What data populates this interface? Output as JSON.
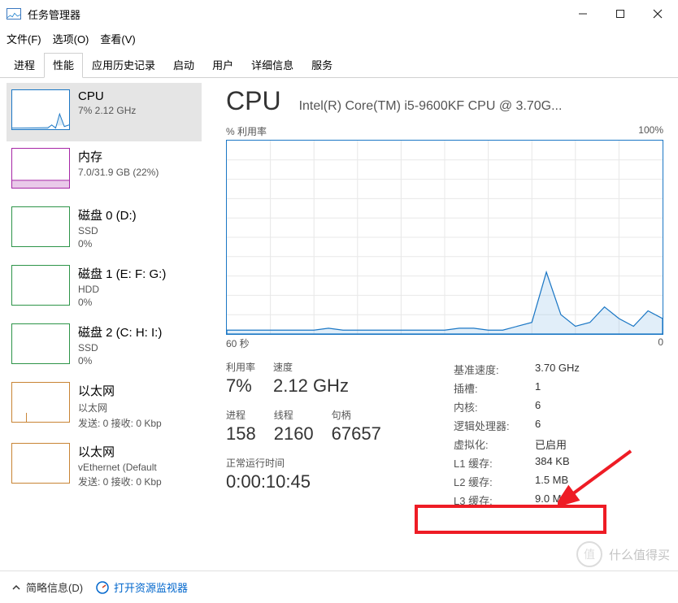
{
  "window": {
    "title": "任务管理器"
  },
  "menu": [
    "文件(F)",
    "选项(O)",
    "查看(V)"
  ],
  "tabs": [
    "进程",
    "性能",
    "应用历史记录",
    "启动",
    "用户",
    "详细信息",
    "服务"
  ],
  "active_tab": 1,
  "sidebar": {
    "items": [
      {
        "name": "CPU",
        "sub1": "7% 2.12 GHz",
        "type": "cpu"
      },
      {
        "name": "内存",
        "sub1": "7.0/31.9 GB (22%)",
        "type": "memory"
      },
      {
        "name": "磁盘 0 (D:)",
        "sub1": "SSD",
        "sub2": "0%",
        "type": "disk"
      },
      {
        "name": "磁盘 1 (E: F: G:)",
        "sub1": "HDD",
        "sub2": "0%",
        "type": "disk"
      },
      {
        "name": "磁盘 2 (C: H: I:)",
        "sub1": "SSD",
        "sub2": "0%",
        "type": "disk"
      },
      {
        "name": "以太网",
        "sub1": "以太网",
        "sub2": "发送: 0 接收: 0 Kbp",
        "type": "net"
      },
      {
        "name": "以太网",
        "sub1": "vEthernet (Default",
        "sub2": "发送: 0 接收: 0 Kbp",
        "type": "net"
      }
    ]
  },
  "detail": {
    "title": "CPU",
    "subtitle": "Intel(R) Core(TM) i5-9600KF CPU @ 3.70G...",
    "chart": {
      "top_left": "% 利用率",
      "top_right": "100%",
      "bottom_left": "60 秒",
      "bottom_right": "0"
    },
    "stats_left": [
      [
        {
          "label": "利用率",
          "value": "7%"
        },
        {
          "label": "速度",
          "value": "2.12 GHz"
        }
      ],
      [
        {
          "label": "进程",
          "value": "158"
        },
        {
          "label": "线程",
          "value": "2160"
        },
        {
          "label": "句柄",
          "value": "67657"
        }
      ]
    ],
    "uptime_label": "正常运行时间",
    "uptime_value": "0:00:10:45",
    "stats_right": [
      {
        "k": "基准速度:",
        "v": "3.70 GHz"
      },
      {
        "k": "插槽:",
        "v": "1"
      },
      {
        "k": "内核:",
        "v": "6"
      },
      {
        "k": "逻辑处理器:",
        "v": "6"
      },
      {
        "k": "虚拟化:",
        "v": "已启用"
      },
      {
        "k": "L1 缓存:",
        "v": "384 KB"
      },
      {
        "k": "L2 缓存:",
        "v": "1.5 MB"
      },
      {
        "k": "L3 缓存:",
        "v": "9.0 MB"
      }
    ]
  },
  "footer": {
    "less": "简略信息(D)",
    "link": "打开资源监视器"
  },
  "chart_data": {
    "type": "line",
    "title": "% 利用率",
    "xlabel": "秒",
    "ylabel": "% 利用率",
    "xlim": [
      60,
      0
    ],
    "ylim": [
      0,
      100
    ],
    "series": [
      {
        "name": "CPU 利用率",
        "x": [
          60,
          58,
          56,
          54,
          52,
          50,
          48,
          46,
          44,
          42,
          40,
          38,
          36,
          34,
          32,
          30,
          28,
          26,
          24,
          22,
          20,
          18,
          16,
          14,
          12,
          10,
          8,
          6,
          4,
          2,
          0
        ],
        "values": [
          2,
          2,
          2,
          2,
          2,
          2,
          2,
          3,
          2,
          2,
          2,
          2,
          2,
          2,
          2,
          2,
          3,
          3,
          2,
          2,
          4,
          6,
          32,
          10,
          4,
          6,
          14,
          8,
          4,
          12,
          8
        ]
      }
    ]
  },
  "watermark": {
    "badge": "值",
    "text": "什么值得买"
  }
}
